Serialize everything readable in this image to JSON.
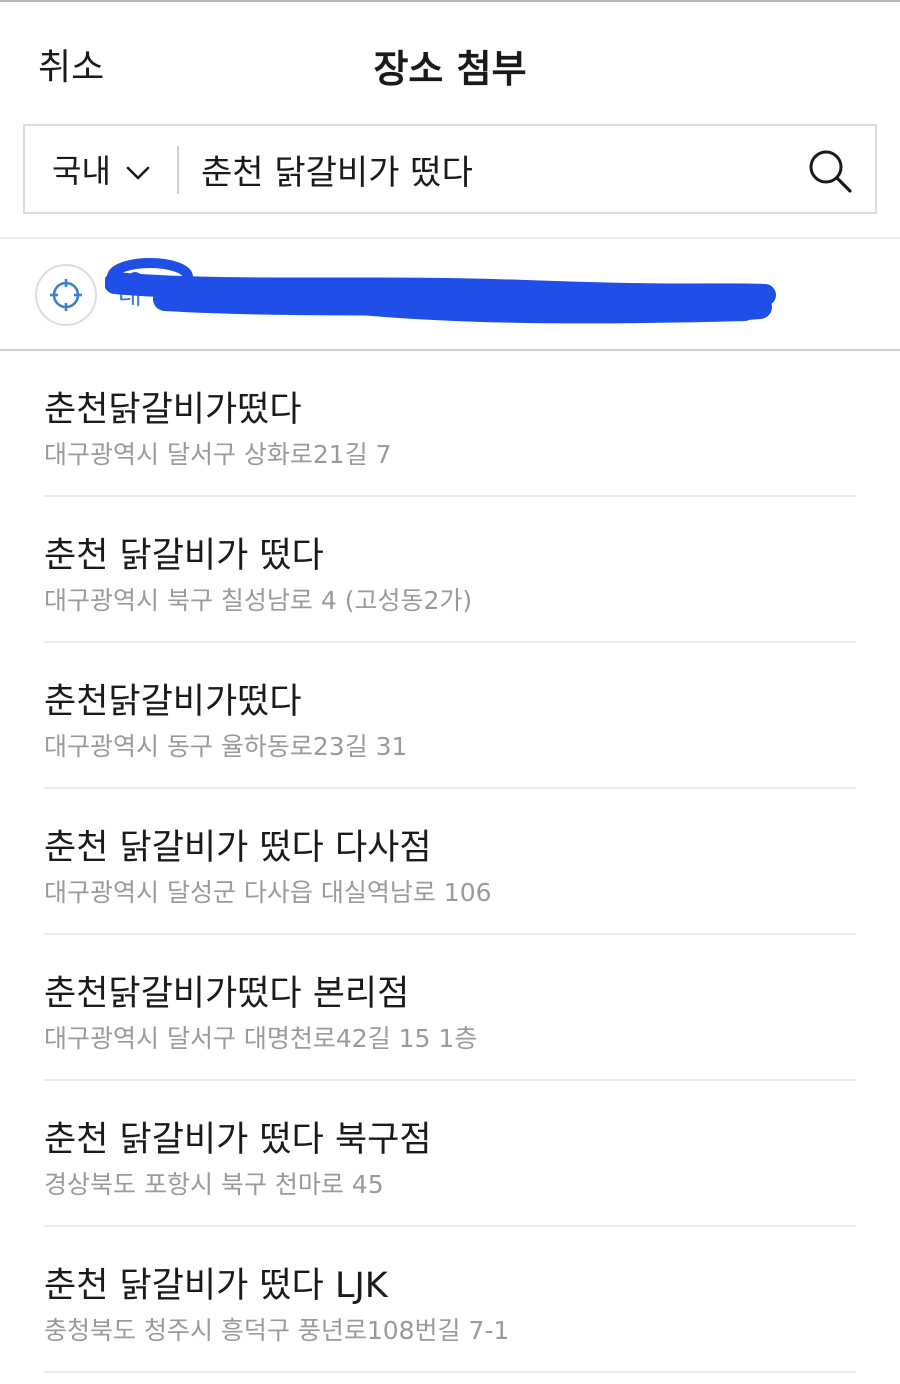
{
  "header": {
    "cancel_label": "취소",
    "title": "장소 첨부"
  },
  "search": {
    "region_label": "국내",
    "query": "춘천 닭갈비가 떴다"
  },
  "current_location": {
    "text": "대"
  },
  "results": [
    {
      "name": "춘천닭갈비가떴다",
      "address": "대구광역시 달서구 상화로21길 7"
    },
    {
      "name": "춘천 닭갈비가 떴다",
      "address": "대구광역시 북구 칠성남로 4 (고성동2가)"
    },
    {
      "name": "춘천닭갈비가떴다",
      "address": "대구광역시 동구 율하동로23길 31"
    },
    {
      "name": "춘천 닭갈비가 떴다 다사점",
      "address": "대구광역시 달성군 다사읍 대실역남로 106"
    },
    {
      "name": "춘천닭갈비가떴다 본리점",
      "address": "대구광역시 달서구 대명천로42길 15 1층"
    },
    {
      "name": "춘천 닭갈비가 떴다 북구점",
      "address": "경상북도 포항시 북구 천마로 45"
    },
    {
      "name": "춘천 닭갈비가 떴다 LJK",
      "address": "충청북도 청주시 흥덕구 풍년로108번길 7-1"
    }
  ],
  "colors": {
    "accent": "#3a7fd0",
    "redaction": "#1f4fe6",
    "secondary_text": "#9a9a9a"
  }
}
